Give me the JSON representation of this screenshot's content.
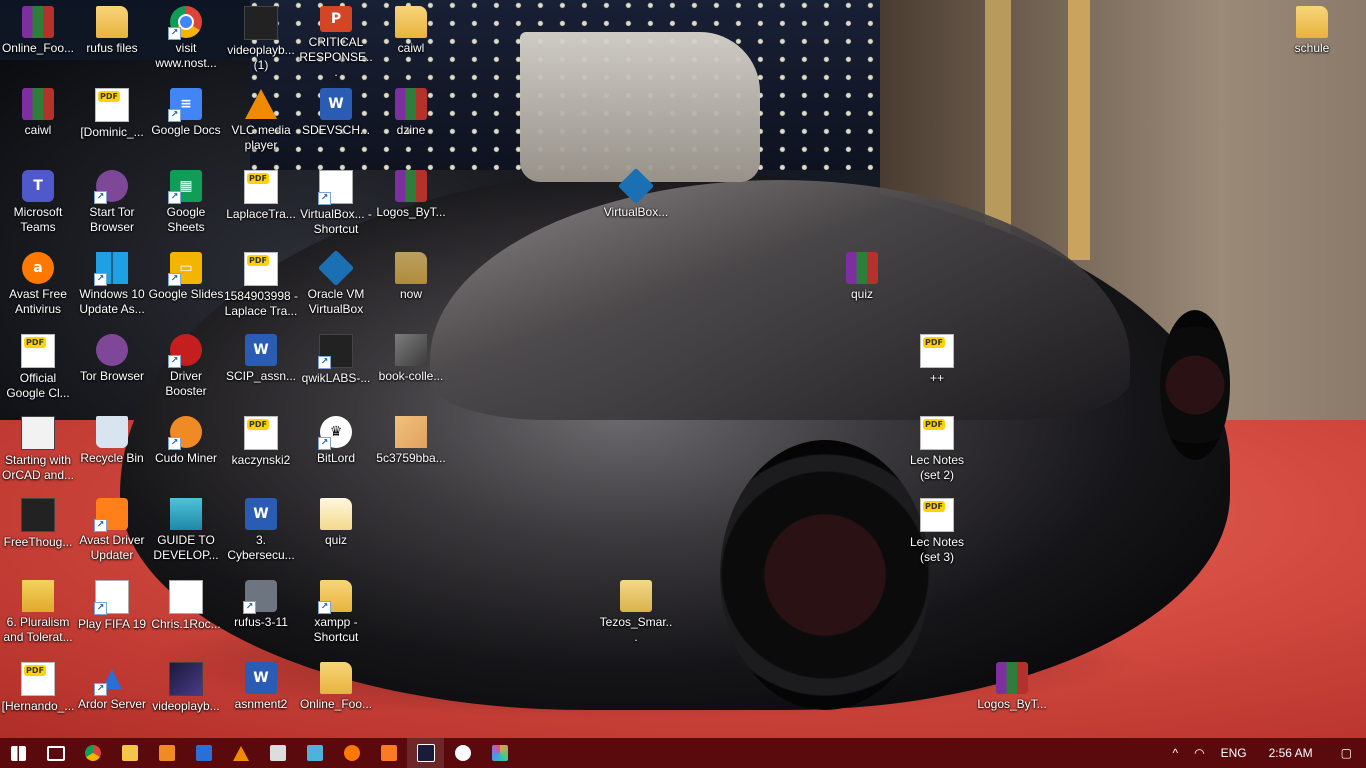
{
  "desktop": {
    "icons": [
      {
        "label": "Online_Foo...",
        "icon": "winrar-icon"
      },
      {
        "label": "rufus files",
        "icon": "folder-icon"
      },
      {
        "label": "visit www.nost...",
        "icon": "chrome-icon"
      },
      {
        "label": "videoplayb... (1)",
        "icon": "video-thumbnail-icon"
      },
      {
        "label": "CRITICAL RESPONSE...",
        "icon": "powerpoint-icon"
      },
      {
        "label": "caiwl",
        "icon": "folder-icon"
      },
      {
        "label": "schule",
        "icon": "folder-icon"
      },
      {
        "label": "caiwl",
        "icon": "winrar-icon"
      },
      {
        "label": "[Dominic_...",
        "icon": "pdf-icon"
      },
      {
        "label": "Google Docs",
        "icon": "google-docs-icon"
      },
      {
        "label": "VLC media player",
        "icon": "vlc-icon"
      },
      {
        "label": "SDEVSCH...",
        "icon": "word-icon"
      },
      {
        "label": "dzine",
        "icon": "winrar-icon"
      },
      {
        "label": "Microsoft Teams",
        "icon": "teams-icon"
      },
      {
        "label": "Start Tor Browser",
        "icon": "tor-icon"
      },
      {
        "label": "Google Sheets",
        "icon": "google-sheets-icon"
      },
      {
        "label": "LaplaceTra...",
        "icon": "pdf-icon"
      },
      {
        "label": "VirtualBox... - Shortcut",
        "icon": "file-icon"
      },
      {
        "label": "Logos_ByT...",
        "icon": "winrar-icon"
      },
      {
        "label": "VirtualBox...",
        "icon": "virtualbox-icon"
      },
      {
        "label": "Avast Free Antivirus",
        "icon": "avast-icon"
      },
      {
        "label": "Windows 10 Update As...",
        "icon": "windows-icon"
      },
      {
        "label": "Google Slides",
        "icon": "google-slides-icon"
      },
      {
        "label": "1584903998 - Laplace Tra...",
        "icon": "pdf-icon"
      },
      {
        "label": "Oracle VM VirtualBox",
        "icon": "virtualbox-icon"
      },
      {
        "label": "now",
        "icon": "folder-icon"
      },
      {
        "label": "quiz",
        "icon": "winrar-icon"
      },
      {
        "label": "Official Google Cl...",
        "icon": "pdf-icon"
      },
      {
        "label": "Tor Browser",
        "icon": "tor-icon"
      },
      {
        "label": "Driver Booster",
        "icon": "driver-booster-icon"
      },
      {
        "label": "SCIP_assn...",
        "icon": "word-icon"
      },
      {
        "label": "qwikLABS-...",
        "icon": "app-icon"
      },
      {
        "label": "book-colle...",
        "icon": "image-icon"
      },
      {
        "label": "++",
        "icon": "pdf-icon"
      },
      {
        "label": "Starting with OrCAD and...",
        "icon": "video-thumbnail-icon"
      },
      {
        "label": "Recycle Bin",
        "icon": "recycle-bin-icon"
      },
      {
        "label": "Cudo Miner",
        "icon": "cudo-icon"
      },
      {
        "label": "kaczynski2",
        "icon": "pdf-icon"
      },
      {
        "label": "BitLord",
        "icon": "bitlord-icon"
      },
      {
        "label": "5c3759bba...",
        "icon": "image-icon"
      },
      {
        "label": "Lec Notes (set 2)",
        "icon": "pdf-icon"
      },
      {
        "label": "FreeThoug...",
        "icon": "image-icon"
      },
      {
        "label": "Avast Driver Updater",
        "icon": "avast-driver-icon"
      },
      {
        "label": "GUIDE TO DEVELOP...",
        "icon": "image-icon"
      },
      {
        "label": "3. Cybersecu...",
        "icon": "word-icon"
      },
      {
        "label": "quiz",
        "icon": "folder-icon"
      },
      {
        "label": "Lec Notes (set 3)",
        "icon": "pdf-icon"
      },
      {
        "label": "6. Pluralism and Tolerat...",
        "icon": "image-icon"
      },
      {
        "label": "Play FIFA 19",
        "icon": "file-icon"
      },
      {
        "label": "Chris.1Roc...",
        "icon": "file-icon"
      },
      {
        "label": "rufus-3-11",
        "icon": "usb-icon"
      },
      {
        "label": "xampp - Shortcut",
        "icon": "folder-icon"
      },
      {
        "label": "Tezos_Smar...",
        "icon": "winrar-icon"
      },
      {
        "label": "[Hernando_...",
        "icon": "pdf-icon"
      },
      {
        "label": "Ardor Server",
        "icon": "ardor-icon"
      },
      {
        "label": "videoplayb...",
        "icon": "video-thumbnail-icon"
      },
      {
        "label": "asnment2",
        "icon": "word-icon"
      },
      {
        "label": "Online_Foo...",
        "icon": "folder-icon"
      },
      {
        "label": "Logos_ByT...",
        "icon": "winrar-icon"
      }
    ]
  },
  "taskbar": {
    "pinned": [
      {
        "name": "start-button",
        "icon": "windows-logo-icon"
      },
      {
        "name": "task-view-button",
        "icon": "task-view-icon"
      },
      {
        "name": "chrome",
        "icon": "chrome-icon"
      },
      {
        "name": "file-explorer",
        "icon": "folder-icon"
      },
      {
        "name": "app-orange",
        "icon": "app-icon"
      },
      {
        "name": "app-blue",
        "icon": "app-icon"
      },
      {
        "name": "vlc",
        "icon": "vlc-icon"
      },
      {
        "name": "app-print",
        "icon": "app-icon"
      },
      {
        "name": "app-teal",
        "icon": "app-icon"
      },
      {
        "name": "avast",
        "icon": "avast-icon"
      },
      {
        "name": "app-xampp",
        "icon": "xampp-icon"
      },
      {
        "name": "powershell",
        "icon": "powershell-icon"
      },
      {
        "name": "bitlord",
        "icon": "bitlord-icon"
      },
      {
        "name": "app-colorful",
        "icon": "app-icon"
      }
    ],
    "tray": {
      "chevron": "^",
      "language": "ENG",
      "time": "2:56 AM"
    }
  }
}
